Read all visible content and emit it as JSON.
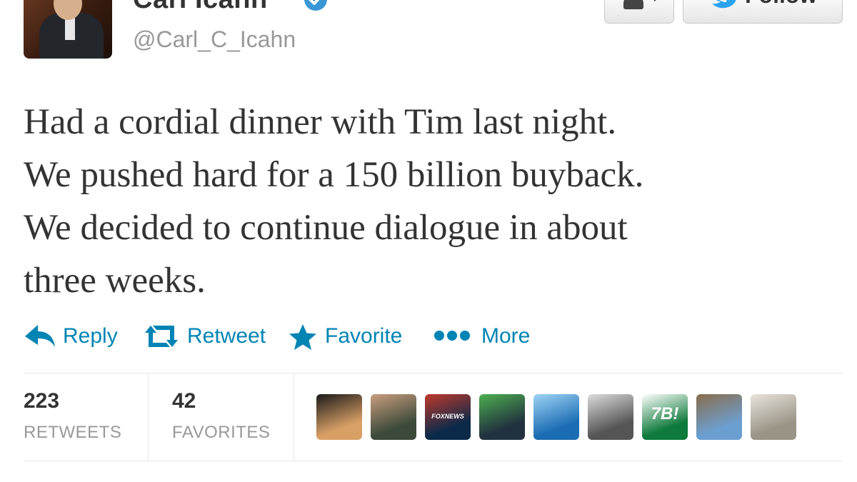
{
  "user": {
    "name": "Carl Icahn",
    "handle": "@Carl_C_Icahn"
  },
  "buttons": {
    "follow_label": "Follow"
  },
  "tweet": {
    "lines": [
      "Had a cordial dinner with Tim last night.",
      "We pushed hard for a 150 billion buyback.",
      "We decided to continue dialogue in about",
      "three weeks."
    ]
  },
  "actions": {
    "reply": "Reply",
    "retweet": "Retweet",
    "favorite": "Favorite",
    "more": "More"
  },
  "stats": {
    "retweets_count": "223",
    "retweets_label": "RETWEETS",
    "favorites_count": "42",
    "favorites_label": "FAVORITES"
  },
  "retweeter_faces": [
    {
      "name": "silhouette-avatar",
      "colors": [
        "#d9a066",
        "#1a1a1a"
      ]
    },
    {
      "name": "man-portrait-avatar",
      "colors": [
        "#3c4a3a",
        "#c99d7e"
      ]
    },
    {
      "name": "foxnews-avatar",
      "colors": [
        "#0b2a4a",
        "#c0392b"
      ],
      "text": "FOXNEWS"
    },
    {
      "name": "trading-screen-avatar",
      "colors": [
        "#22313f",
        "#4caf50"
      ]
    },
    {
      "name": "blue-logo-avatar",
      "colors": [
        "#1b6db3",
        "#9fd3f5"
      ]
    },
    {
      "name": "bw-portrait-avatar",
      "colors": [
        "#555555",
        "#dcdcdc"
      ]
    },
    {
      "name": "sette8-avatar",
      "colors": [
        "#0e7a3b",
        "#ffffff"
      ],
      "text": "7B!"
    },
    {
      "name": "outdoor-person-avatar",
      "colors": [
        "#6c9fd1",
        "#8a6d4c"
      ]
    },
    {
      "name": "animal-avatar",
      "colors": [
        "#9a9486",
        "#e8e4dc"
      ]
    }
  ]
}
